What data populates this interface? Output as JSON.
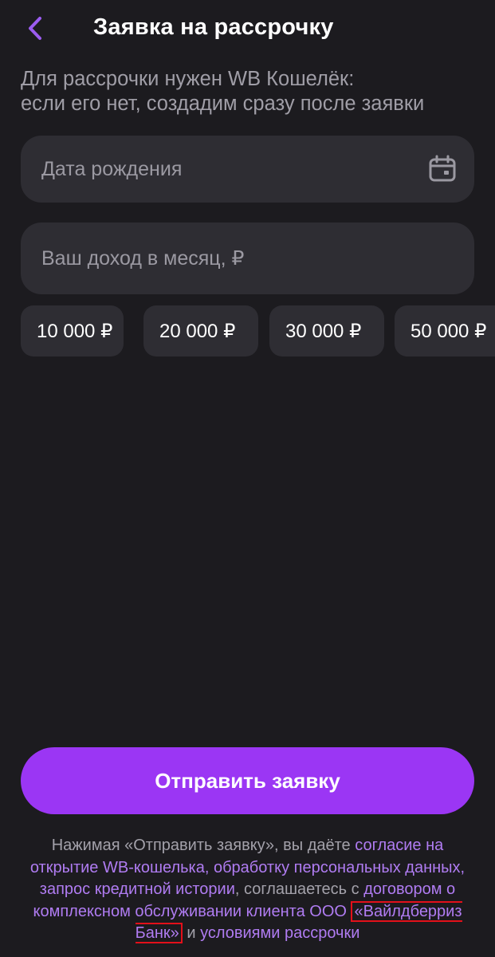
{
  "header": {
    "title": "Заявка на рассрочку",
    "back_icon": "chevron-left-icon"
  },
  "subtitle": {
    "line1": "Для рассрочки нужен WB Кошелёк:",
    "line2": "если его нет, создадим сразу после заявки"
  },
  "form": {
    "birth_date": {
      "placeholder": "Дата рождения",
      "value": "",
      "icon": "calendar-icon"
    },
    "income": {
      "placeholder": "Ваш доход в месяц, ₽",
      "value": ""
    }
  },
  "income_chips": [
    "10 000 ₽",
    "20 000 ₽",
    "30 000 ₽",
    "50 000 ₽"
  ],
  "submit_label": "Отправить заявку",
  "legal": {
    "prefix": "Нажимая «Отправить заявку», вы даёте ",
    "link_consent": "согласие на открытие WB-кошелька, обработку персональных данных, запрос кредитной истории",
    "middle": ", соглашаетесь с ",
    "link_contract": "договором о комплексном обслуживании клиента ООО ",
    "link_bank": "«Вайлдберриз Банк»",
    "conjunction": " и ",
    "link_terms": "условиями рассрочки"
  },
  "colors": {
    "background": "#1c1b1f",
    "field": "#2e2d33",
    "accent": "#9b36f4",
    "link": "#b07cf2",
    "highlight_box": "#e3101a"
  }
}
